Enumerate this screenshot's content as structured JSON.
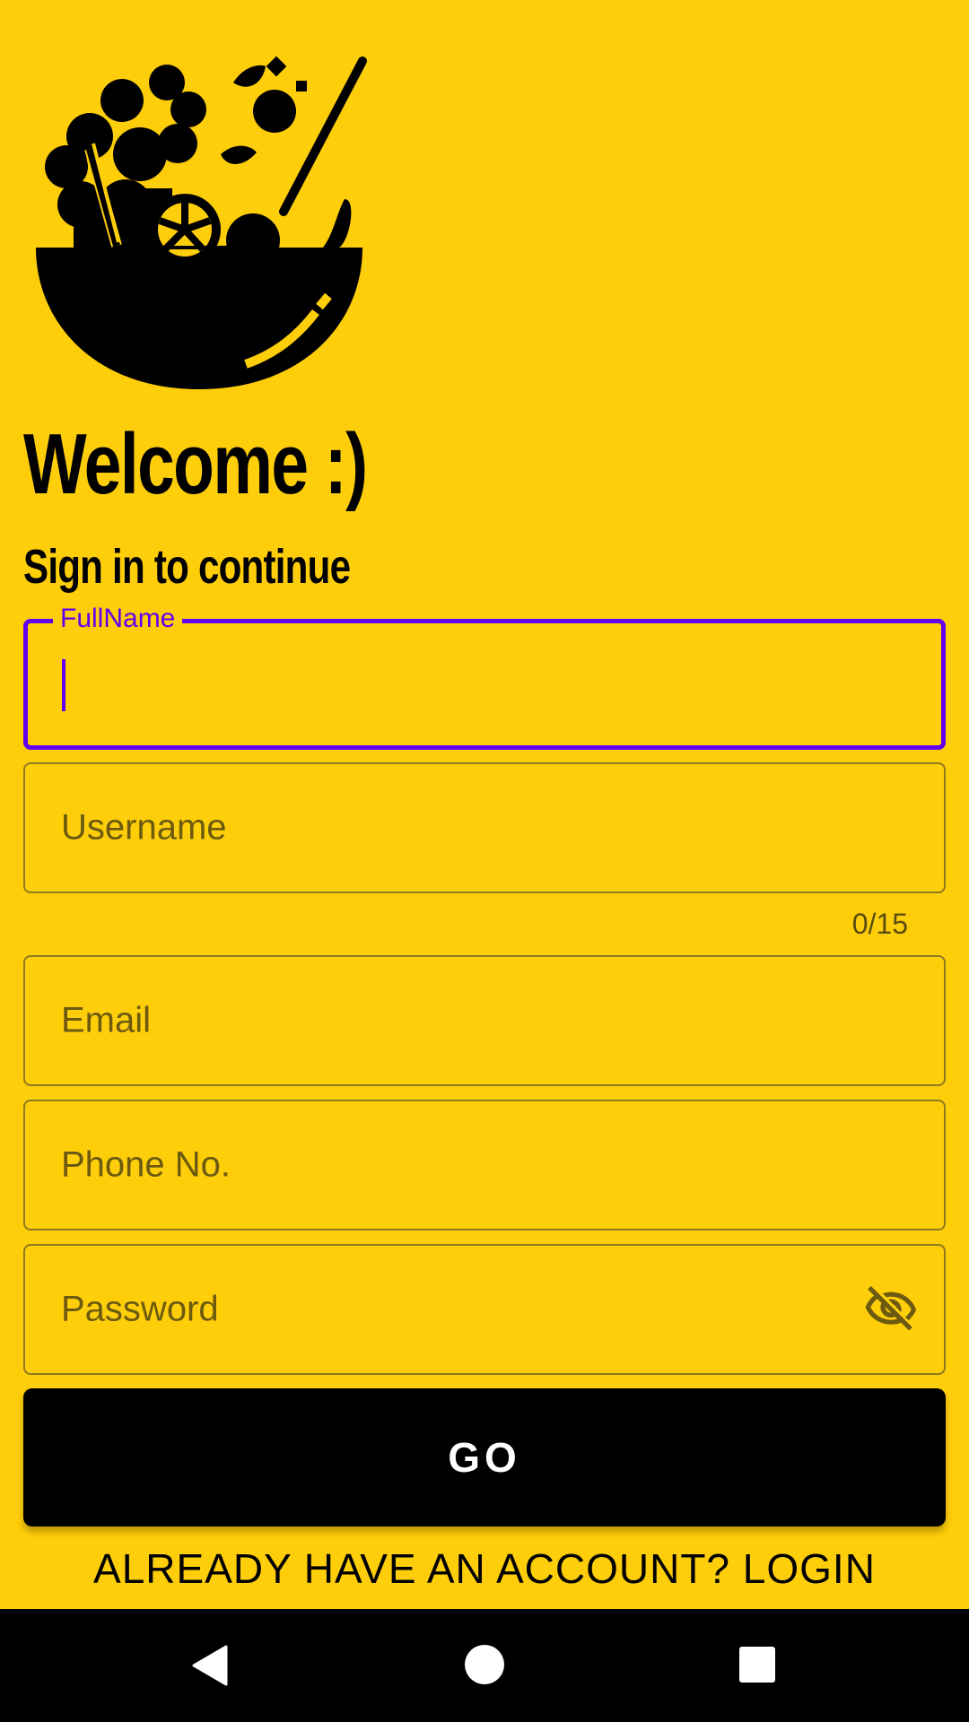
{
  "app": {
    "welcome_title": "Welcome :)",
    "subtitle": "Sign in to continue",
    "logo_icon": "salad-bowl-icon"
  },
  "form": {
    "fullname": {
      "label": "FullName",
      "value": ""
    },
    "username": {
      "placeholder": "Username",
      "counter": "0/15",
      "max_length": 15
    },
    "email": {
      "placeholder": "Email"
    },
    "phone": {
      "placeholder": "Phone No."
    },
    "password": {
      "placeholder": "Password",
      "toggle_icon": "eye-off-icon"
    }
  },
  "actions": {
    "go_label": "GO",
    "login_link": "ALREADY HAVE AN ACCOUNT? LOGIN"
  },
  "navbar": {
    "back_icon": "back-triangle-icon",
    "home_icon": "home-circle-icon",
    "recents_icon": "recents-square-icon"
  },
  "colors": {
    "background": "#FFCE0A",
    "accent": "#6200EE",
    "button": "#000000",
    "text": "#000000"
  }
}
